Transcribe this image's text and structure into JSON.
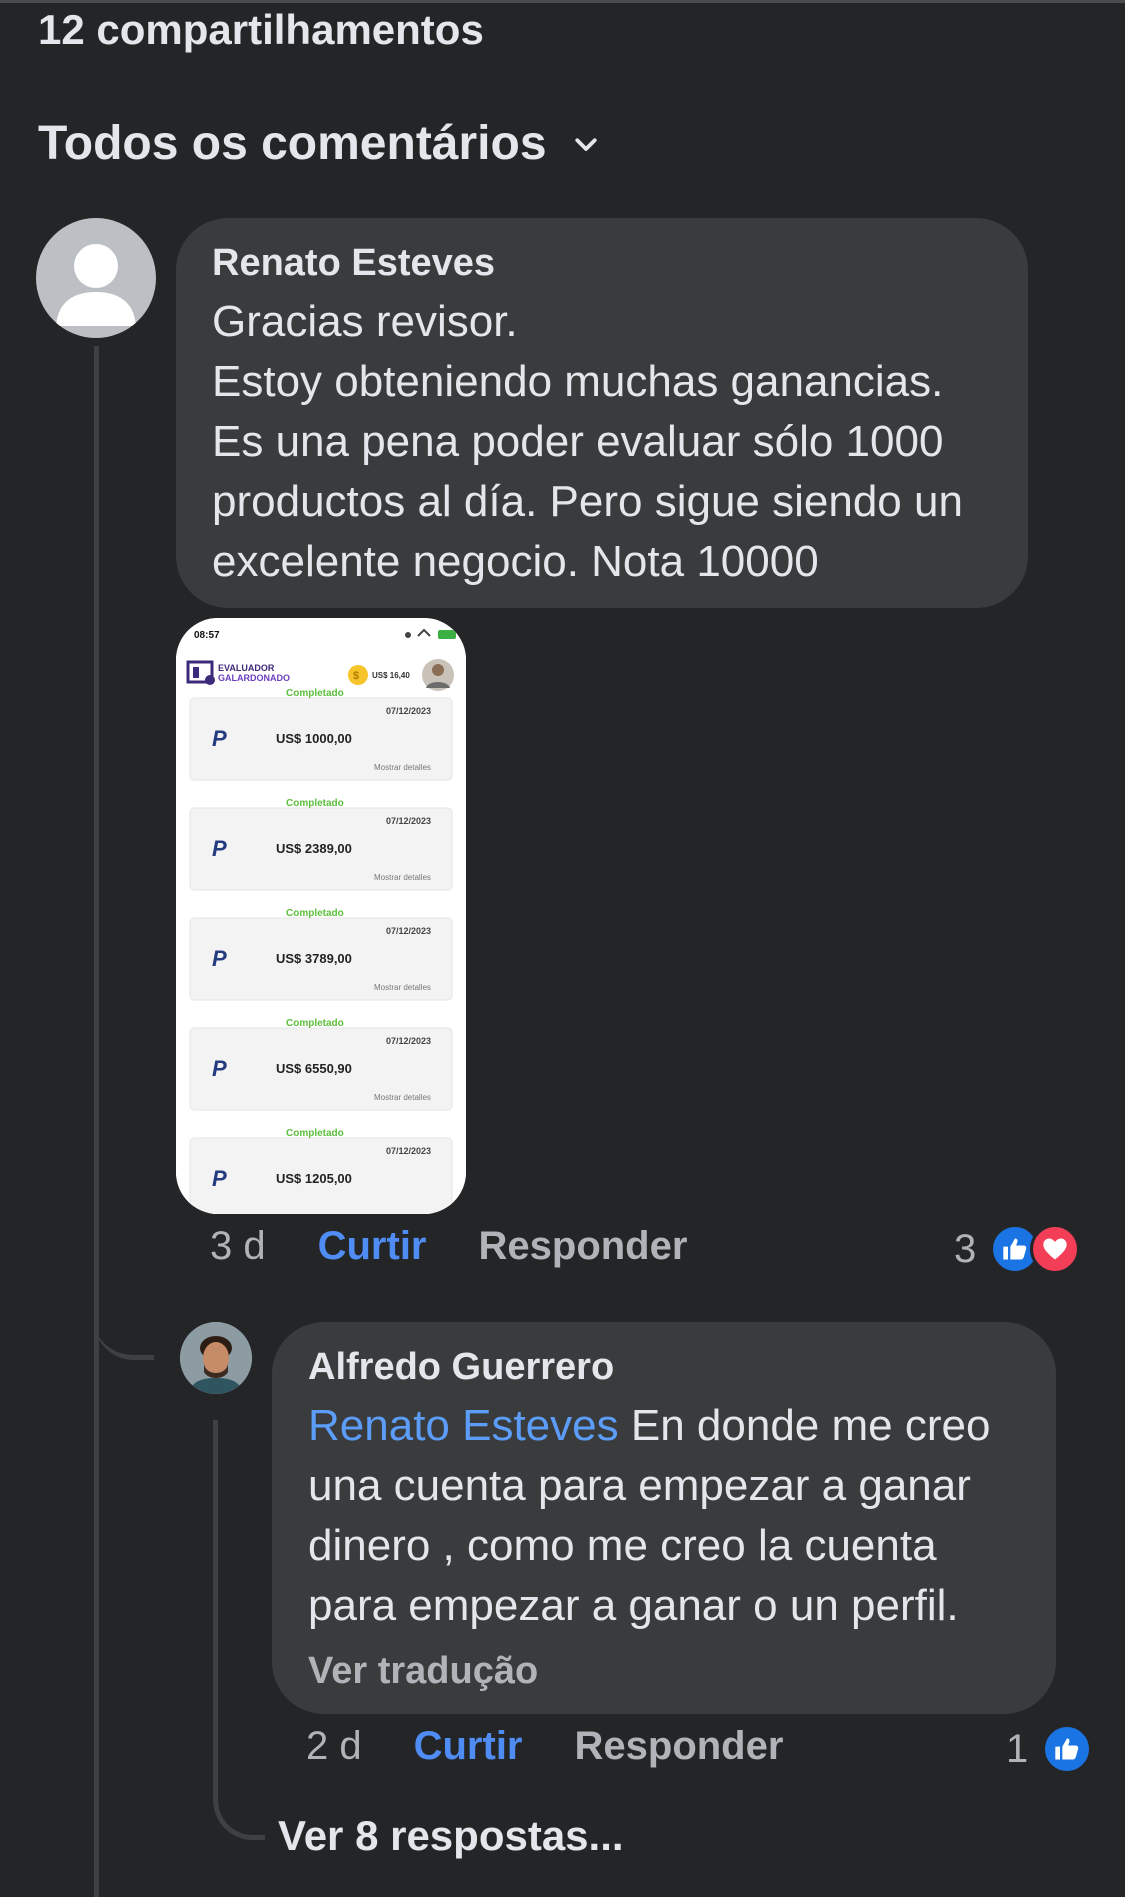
{
  "header": {
    "shares": "12 compartilhamentos",
    "filter_label": "Todos os comentários"
  },
  "comment1": {
    "author": "Renato Esteves",
    "text": "Gracias revisor.\nEstoy obteniendo muchas ganancias. Es una pena poder evaluar sólo 1000 productos al día. Pero sigue siendo un excelente negocio. Nota 10000",
    "time": "3 d",
    "like": "Curtir",
    "reply": "Responder",
    "reaction_count": "3",
    "attachment": {
      "status_time": "08:57",
      "brand_top": "EVALUADOR",
      "brand_bottom": "GALARDONADO",
      "balance": "US$ 16,40",
      "payments": [
        {
          "status": "Completado",
          "date": "07/12/2023",
          "amount": "US$ 1000,00",
          "details": "Mostrar detalles"
        },
        {
          "status": "Completado",
          "date": "07/12/2023",
          "amount": "US$ 2389,00",
          "details": "Mostrar detalles"
        },
        {
          "status": "Completado",
          "date": "07/12/2023",
          "amount": "US$ 3789,00",
          "details": "Mostrar detalles"
        },
        {
          "status": "Completado",
          "date": "07/12/2023",
          "amount": "US$ 6550,90",
          "details": "Mostrar detalles"
        },
        {
          "status": "Completado",
          "date": "07/12/2023",
          "amount": "US$ 1205,00",
          "details": ""
        }
      ]
    }
  },
  "comment2": {
    "author": "Alfredo Guerrero",
    "mention": "Renato Esteves",
    "text": "En donde me creo una cuenta para empezar a ganar dinero , como me creo la cuenta para empezar a ganar o un perfil.",
    "translate": "Ver tradução",
    "time": "2 d",
    "like": "Curtir",
    "reply": "Responder",
    "reaction_count": "1"
  },
  "more_replies": "Ver 8 respostas...",
  "colors": {
    "background": "#242527",
    "bubble": "#3a3b3c",
    "link_blue": "#4f8df5",
    "like_blue": "#1b74e4",
    "love_red": "#f33e58"
  }
}
